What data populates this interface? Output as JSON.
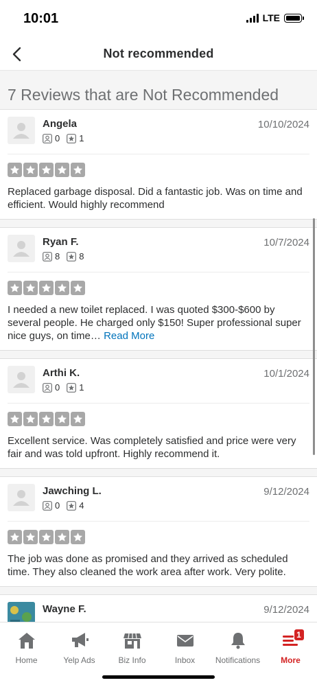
{
  "status": {
    "time": "10:01",
    "network": "LTE"
  },
  "nav": {
    "title": "Not recommended"
  },
  "section": {
    "heading": "7 Reviews that are Not Recommended"
  },
  "reviews": [
    {
      "name": "Angela",
      "date": "10/10/2024",
      "friends": "0",
      "reviews": "1",
      "rating": 0,
      "text": "Replaced garbage disposal.  Did a fantastic job.  Was on time and efficient. Would highly recommend",
      "read_more": ""
    },
    {
      "name": "Ryan F.",
      "date": "10/7/2024",
      "friends": "8",
      "reviews": "8",
      "rating": 0,
      "text": "I needed a new toilet replaced. I was quoted $300-$600 by several people. He charged only $150! Super professional super nice guys, on time…",
      "read_more": "Read More"
    },
    {
      "name": "Arthi K.",
      "date": "10/1/2024",
      "friends": "0",
      "reviews": "1",
      "rating": 0,
      "text": "Excellent service. Was completely satisfied and price were very fair and was told upfront. Highly recommend it.",
      "read_more": ""
    },
    {
      "name": "Jawching L.",
      "date": "9/12/2024",
      "friends": "0",
      "reviews": "4",
      "rating": 0,
      "text": "The job was done as promised and they arrived as scheduled time. They also cleaned the work area after work. Very polite.",
      "read_more": ""
    },
    {
      "name": "Wayne F.",
      "date": "9/12/2024",
      "friends": "",
      "reviews": "",
      "rating": 0,
      "text": "",
      "read_more": ""
    }
  ],
  "tabs": [
    {
      "label": "Home",
      "icon": "home-icon"
    },
    {
      "label": "Yelp Ads",
      "icon": "megaphone-icon"
    },
    {
      "label": "Biz Info",
      "icon": "storefront-icon"
    },
    {
      "label": "Inbox",
      "icon": "envelope-icon"
    },
    {
      "label": "Notifications",
      "icon": "bell-icon"
    },
    {
      "label": "More",
      "icon": "more-menu-icon",
      "badge": "1",
      "active": true
    }
  ],
  "colors": {
    "accent": "#d32323",
    "link": "#0073bb",
    "star_empty": "#a8a8a8"
  }
}
